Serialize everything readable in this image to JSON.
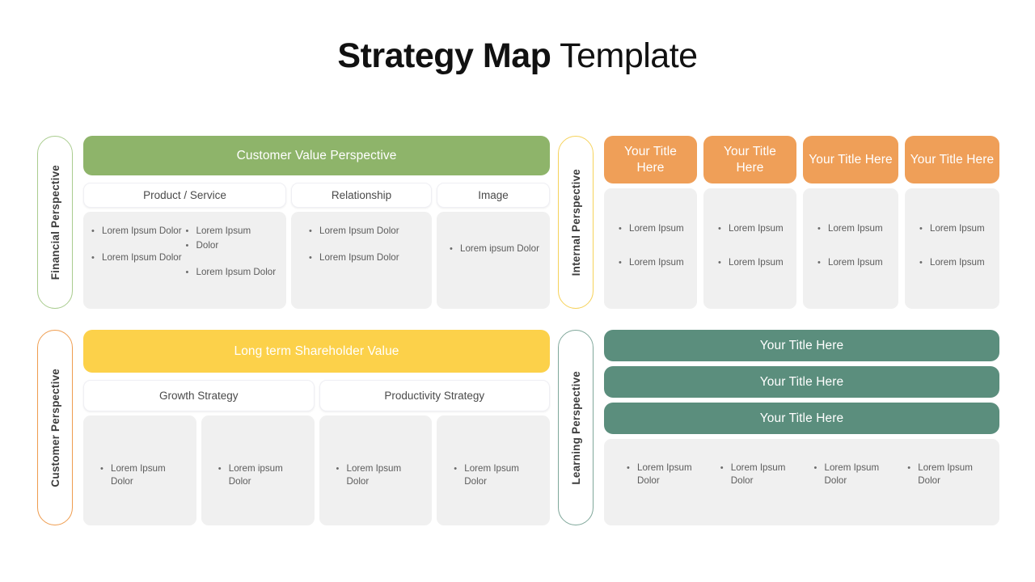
{
  "title": {
    "bold": "Strategy Map",
    "light": " Template"
  },
  "colors": {
    "green": "#8eb46a",
    "yellow": "#fcd14a",
    "orange": "#ef9f58",
    "teal": "#5b8e7d",
    "gray_panel": "#f0f0f0",
    "tab_border_green": "#a9cc8e",
    "tab_border_orange": "#ef9c4e",
    "tab_border_yellow": "#f6d25a",
    "tab_border_teal": "#7fa79a"
  },
  "financial": {
    "tab_label": "Financial Perspective",
    "banner": "Customer Value Perspective",
    "columns": [
      {
        "header": "Product / Service",
        "sub_left": [
          "Lorem Ipsum Dolor",
          "Lorem Ipsum Dolor"
        ],
        "sub_right": [
          "Lorem Ipsum",
          "Dolor",
          "Lorem Ipsum Dolor"
        ]
      },
      {
        "header": "Relationship",
        "items": [
          "Lorem Ipsum Dolor",
          "Lorem Ipsum Dolor"
        ]
      },
      {
        "header": "Image",
        "items": [
          "Lorem ipsum Dolor"
        ]
      }
    ]
  },
  "customer": {
    "tab_label": "Customer Perspective",
    "banner": "Long term Shareholder Value",
    "groups": [
      {
        "header": "Growth Strategy",
        "boxes": [
          {
            "items": [
              "Lorem Ipsum Dolor"
            ]
          },
          {
            "items": [
              "Lorem ipsum Dolor"
            ]
          }
        ]
      },
      {
        "header": "Productivity Strategy",
        "boxes": [
          {
            "items": [
              "Lorem Ipsum Dolor"
            ]
          },
          {
            "items": [
              "Lorem Ipsum Dolor"
            ]
          }
        ]
      }
    ]
  },
  "internal": {
    "tab_label": "Internal Perspective",
    "cards": [
      {
        "title": "Your Title Here",
        "items": [
          "Lorem Ipsum",
          "Lorem Ipsum"
        ]
      },
      {
        "title": "Your Title Here",
        "items": [
          "Lorem Ipsum",
          "Lorem Ipsum"
        ]
      },
      {
        "title": "Your Title Here",
        "items": [
          "Lorem Ipsum",
          "Lorem Ipsum"
        ]
      },
      {
        "title": "Your Title Here",
        "items": [
          "Lorem Ipsum",
          "Lorem Ipsum"
        ]
      }
    ]
  },
  "learning": {
    "tab_label": "Learning Perspective",
    "bars": [
      "Your Title Here",
      "Your Title Here",
      "Your Title Here"
    ],
    "bullets": [
      "Lorem Ipsum Dolor",
      "Lorem Ipsum Dolor",
      "Lorem Ipsum Dolor",
      "Lorem Ipsum Dolor"
    ]
  }
}
